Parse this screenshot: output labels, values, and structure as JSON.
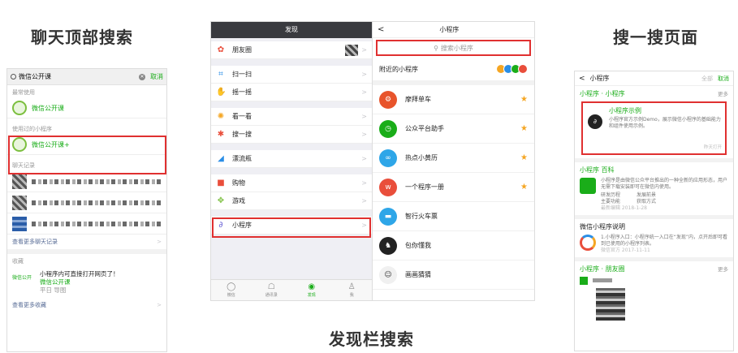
{
  "captions": {
    "chat_search": "聊天顶部搜索",
    "discover_search": "发现栏搜索",
    "sousou_page": "搜一搜页面"
  },
  "panel1": {
    "search_value": "微信公开课",
    "cancel": "取消",
    "recent_label": "最常使用",
    "recent_item": "微信公开课",
    "used_label": "使用过的小程序",
    "used_item": "微信公开课+",
    "chat_label": "聊天记录",
    "more_chats": "查看更多聊天记录",
    "fav_label": "收藏",
    "fav_tag": "微信公开",
    "fav_line1": "小程序内可直接打开网页了！",
    "fav_line2": "微信公开课",
    "fav_line3": "平日 导图",
    "more_favs": "查看更多收藏"
  },
  "panel2": {
    "left_title": "发现",
    "left_items": [
      {
        "label": "朋友圈",
        "icon": "moments-icon",
        "glyph": "✿",
        "color": "#e94e3b"
      },
      {
        "label": "扫一扫",
        "icon": "scan-icon",
        "glyph": "⌗",
        "color": "#2a8ee6"
      },
      {
        "label": "摇一摇",
        "icon": "shake-icon",
        "glyph": "✋",
        "color": "#2a8ee6"
      },
      {
        "label": "看一看",
        "icon": "look-icon",
        "glyph": "✺",
        "color": "#f5a623"
      },
      {
        "label": "搜一搜",
        "icon": "search-icon",
        "glyph": "✱",
        "color": "#e94e3b"
      },
      {
        "label": "漂流瓶",
        "icon": "bottle-icon",
        "glyph": "◢",
        "color": "#2a8ee6"
      },
      {
        "label": "购物",
        "icon": "shopping-icon",
        "glyph": "■",
        "color": "#e94e3b"
      },
      {
        "label": "游戏",
        "icon": "game-icon",
        "glyph": "✥",
        "color": "#7cbf3f"
      },
      {
        "label": "小程序",
        "icon": "miniprogram-icon",
        "glyph": "∂",
        "color": "#6b64d6"
      }
    ],
    "tabs": [
      {
        "label": "微信",
        "glyph": "◯"
      },
      {
        "label": "通讯录",
        "glyph": "☖"
      },
      {
        "label": "发现",
        "glyph": "◉"
      },
      {
        "label": "我",
        "glyph": "♙"
      }
    ],
    "right_title": "小程序",
    "right_search_placeholder": "搜索小程序",
    "nearby": "附近的小程序",
    "apps": [
      {
        "name": "摩拜单车",
        "icon": "mobike-icon",
        "color": "#e8542b",
        "glyph": "⚙"
      },
      {
        "name": "公众平台助手",
        "icon": "mp-assistant-icon",
        "color": "#1aad19",
        "glyph": "◷"
      },
      {
        "name": "热点小黄历",
        "icon": "almanac-icon",
        "color": "#2ea6e8",
        "glyph": "∞"
      },
      {
        "name": "一个程序一册",
        "icon": "book-icon",
        "color": "#e94e3b",
        "glyph": "w"
      },
      {
        "name": "智行火车票",
        "icon": "train-icon",
        "color": "#2ea6e8",
        "glyph": "▬"
      },
      {
        "name": "包你懂我",
        "icon": "game-head-icon",
        "color": "#222222",
        "glyph": "♞"
      },
      {
        "name": "画画猜猜",
        "icon": "draw-guess-icon",
        "color": "#f0f0f0",
        "glyph": "☺"
      }
    ]
  },
  "panel3": {
    "query": "小程序",
    "all": "全部",
    "cancel": "取消",
    "sec1_title": "小程序 · 小程序",
    "more": "更多",
    "card_name": "小程序示例",
    "card_desc": "小程序官方示例Demo，展示微信小程序的基础能力和组件使用示例。",
    "card_time": "昨天打开",
    "sec2_title": "小程序 百科",
    "sec2_desc": "小程序是由微信公众平台推出的一种全新的应用形态，用户无需下载安装即可在微信内使用。",
    "sec2_l1": "研发历程",
    "sec2_r1": "发展前景",
    "sec2_l2": "主要功能",
    "sec2_r2": "获取方式",
    "sec2_meta": "最新编辑 2018-1-28",
    "sec3_title": "微信小程序说明",
    "sec3_desc": "1.小程序入口：小程序统一入口在“发现”内，点开后即可看到已使用的小程序列表。",
    "sec3_meta": "微信官方 2017-11-11",
    "sec4_title": "小程序 · 朋友圈"
  }
}
